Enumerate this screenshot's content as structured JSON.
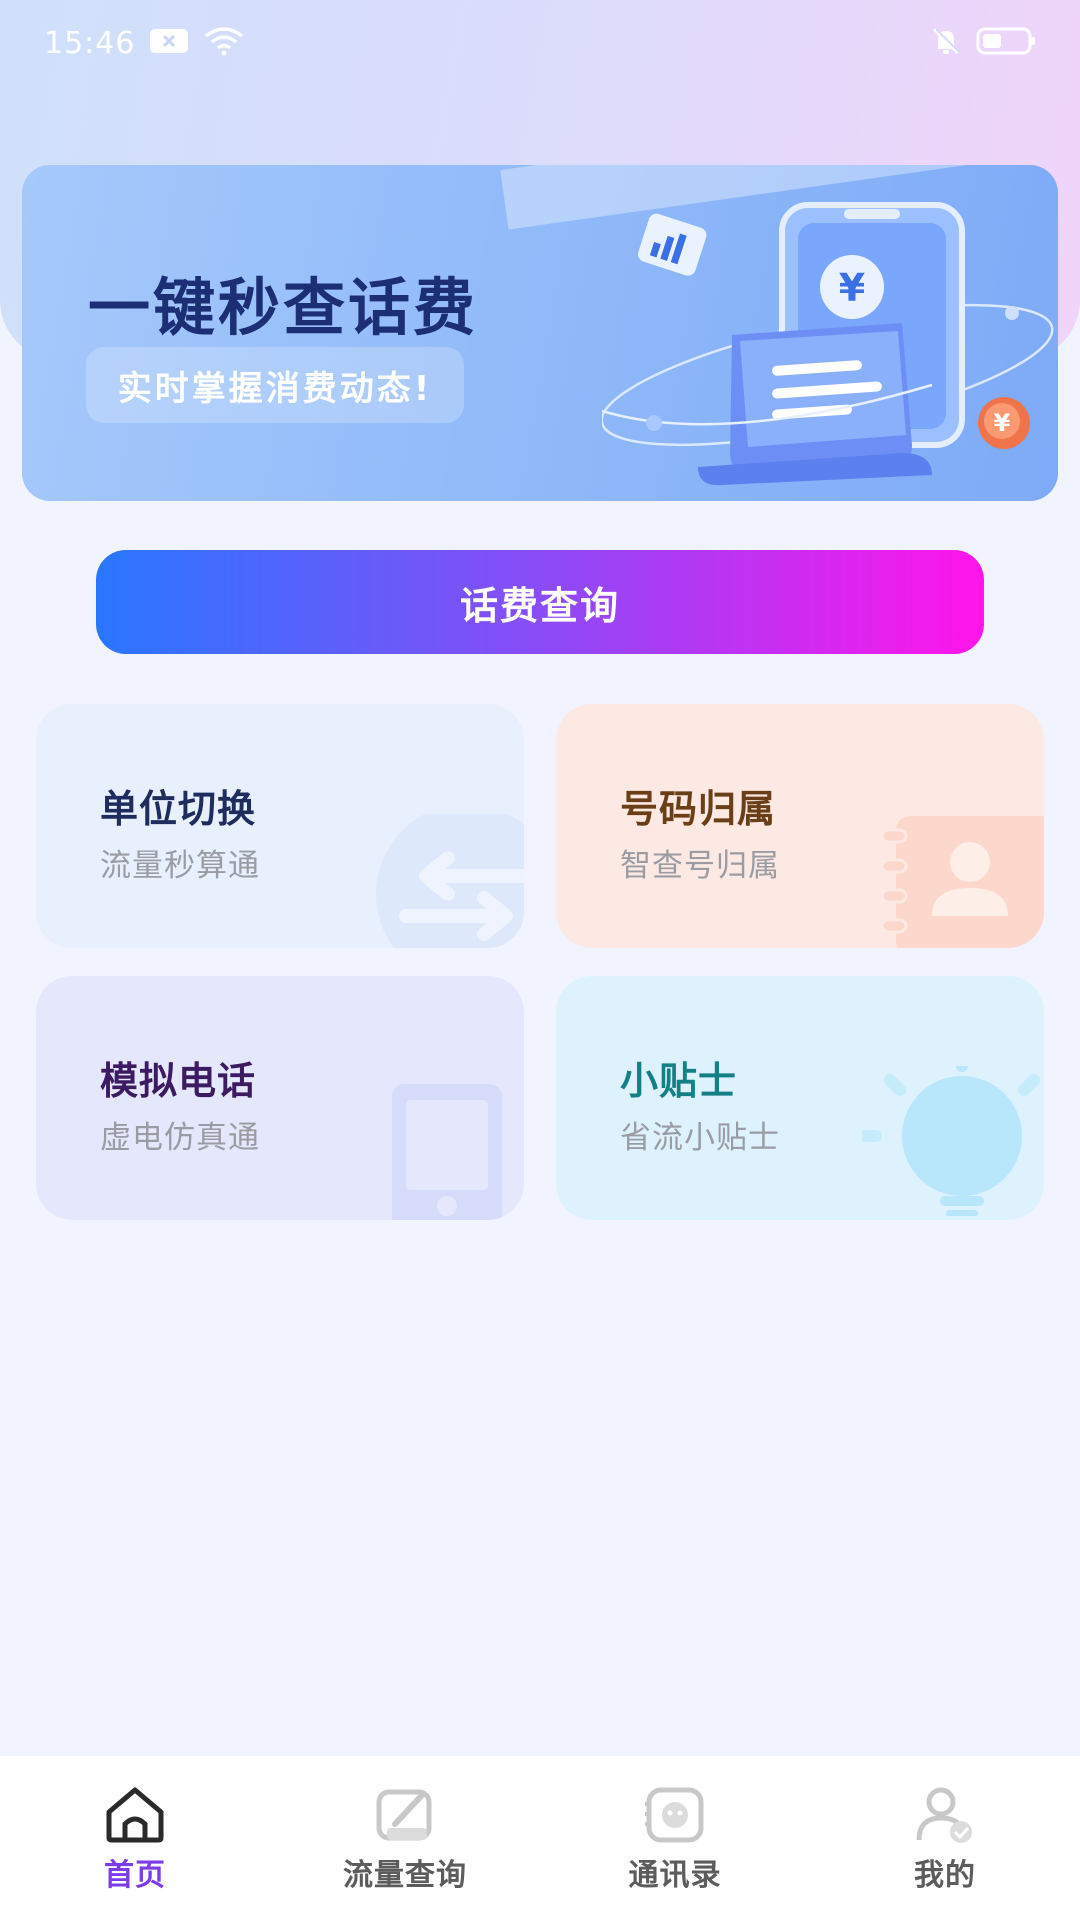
{
  "status_bar": {
    "time": "15:46",
    "icons": [
      "notification-x-icon",
      "wifi-icon",
      "mute-bell-icon",
      "battery-icon"
    ]
  },
  "banner": {
    "title": "一键秒查话费",
    "subtitle": "实时掌握消费动态!",
    "currency_symbol": "¥"
  },
  "primary_button": {
    "label": "话费查询"
  },
  "cards": [
    {
      "title": "单位切换",
      "subtitle": "流量秒算通",
      "icon": "swap-arrows-icon",
      "title_color": "#1f2c5e"
    },
    {
      "title": "号码归属",
      "subtitle": "智查号归属",
      "icon": "contact-book-icon",
      "title_color": "#6a3f17"
    },
    {
      "title": "模拟电话",
      "subtitle": "虚电仿真通",
      "icon": "phone-device-icon",
      "title_color": "#3d1b63"
    },
    {
      "title": "小贴士",
      "subtitle": "省流小贴士",
      "icon": "lightbulb-icon",
      "title_color": "#157f86"
    }
  ],
  "bottom_nav": {
    "items": [
      {
        "label": "首页",
        "icon": "home-icon",
        "active": true
      },
      {
        "label": "流量查询",
        "icon": "edit-icon",
        "active": false
      },
      {
        "label": "通讯录",
        "icon": "contacts-face-icon",
        "active": false
      },
      {
        "label": "我的",
        "icon": "user-check-icon",
        "active": false
      }
    ],
    "active_color": "#7c3ce8"
  },
  "colors": {
    "button_gradient_start": "#2876ff",
    "button_gradient_end": "#ff14ea",
    "banner_title": "#1c2f74",
    "page_background": "#f1f4fe"
  }
}
